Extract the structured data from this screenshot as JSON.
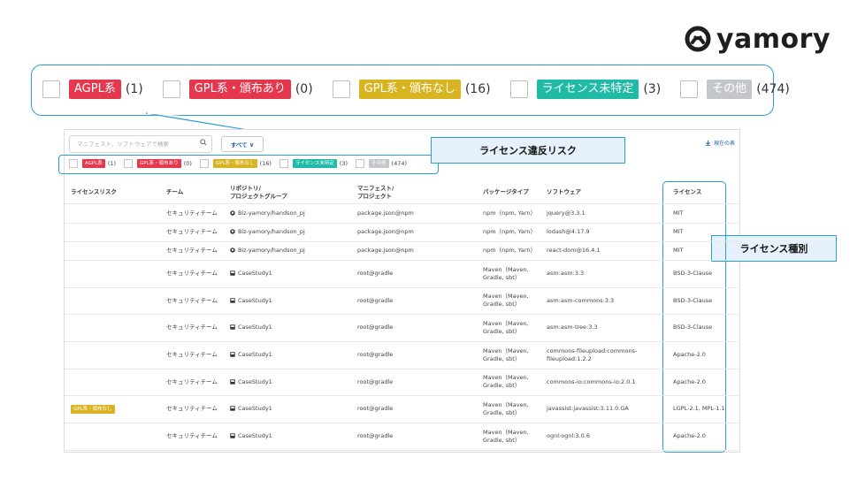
{
  "brand": {
    "name": "yamory",
    "color": "#1e1e1e"
  },
  "colors": {
    "agpl": "#e5384f",
    "gpl_dist": "#e5384f",
    "gpl_nodist": "#d9b421",
    "unknown": "#1fbba6",
    "other": "#c3c7cc",
    "callout": "#2a9fd6"
  },
  "filters": [
    {
      "label": "AGPL系",
      "count": "(1)",
      "color": "#e5384f"
    },
    {
      "label": "GPL系・頒布あり",
      "count": "(0)",
      "color": "#e5384f"
    },
    {
      "label": "GPL系・頒布なし",
      "count": "(16)",
      "color": "#d9b421"
    },
    {
      "label": "ライセンス未特定",
      "count": "(3)",
      "color": "#1fbba6"
    },
    {
      "label": "その他",
      "count": "(474)",
      "color": "#c3c7cc"
    }
  ],
  "toolbar": {
    "search_placeholder": "マニフェスト、ソフトウェアで検索",
    "all_button": "すべて ∨",
    "download": "現在の表"
  },
  "callouts": {
    "risk": "ライセンス違反リスク",
    "type": "ライセンス種別"
  },
  "table": {
    "headers": [
      "ライセンスリスク",
      "チーム",
      "リポジトリ/\nプロジェクトグループ",
      "マニフェスト/\nプロジェクト",
      "パッケージタイプ",
      "ソフトウェア",
      "ライセンス"
    ],
    "rows": [
      {
        "risk": "",
        "team": "セキュリティチーム",
        "repo": "Biz-yamory/handson_pj",
        "repo_icon": "github-icon",
        "manifest": "package.json@npm",
        "pkg": "npm（npm, Yarn）",
        "software": "jquery@3.3.1",
        "license": "MIT"
      },
      {
        "risk": "",
        "team": "セキュリティチーム",
        "repo": "Biz-yamory/handson_pj",
        "repo_icon": "github-icon",
        "manifest": "package.json@npm",
        "pkg": "npm（npm, Yarn）",
        "software": "lodash@4.17.9",
        "license": "MIT"
      },
      {
        "risk": "",
        "team": "セキュリティチーム",
        "repo": "Biz-yamory/handson_pj",
        "repo_icon": "github-icon",
        "manifest": "package.json@npm",
        "pkg": "npm（npm, Yarn）",
        "software": "react-dom@16.4.1",
        "license": "MIT"
      },
      {
        "risk": "",
        "team": "セキュリティチーム",
        "repo": "CaseStudy1",
        "repo_icon": "project-icon",
        "manifest": "root@gradle",
        "pkg": "Maven（Maven,\nGradle, sbt）",
        "software": "asm:asm:3.3",
        "license": "BSD-3-Clause"
      },
      {
        "risk": "",
        "team": "セキュリティチーム",
        "repo": "CaseStudy1",
        "repo_icon": "project-icon",
        "manifest": "root@gradle",
        "pkg": "Maven（Maven,\nGradle, sbt）",
        "software": "asm:asm-commons:3.3",
        "license": "BSD-3-Clause"
      },
      {
        "risk": "",
        "team": "セキュリティチーム",
        "repo": "CaseStudy1",
        "repo_icon": "project-icon",
        "manifest": "root@gradle",
        "pkg": "Maven（Maven,\nGradle, sbt）",
        "software": "asm:asm-tree:3.3",
        "license": "BSD-3-Clause"
      },
      {
        "risk": "",
        "team": "セキュリティチーム",
        "repo": "CaseStudy1",
        "repo_icon": "project-icon",
        "manifest": "root@gradle",
        "pkg": "Maven（Maven,\nGradle, sbt）",
        "software": "commons-fileupload:commons-\nfileupload:1.2.2",
        "license": "Apache-2.0"
      },
      {
        "risk": "",
        "team": "セキュリティチーム",
        "repo": "CaseStudy1",
        "repo_icon": "project-icon",
        "manifest": "root@gradle",
        "pkg": "Maven（Maven,\nGradle, sbt）",
        "software": "commons-io:commons-io:2.0.1",
        "license": "Apache-2.0"
      },
      {
        "risk": "GPL系・頒布なし",
        "team": "セキュリティチーム",
        "repo": "CaseStudy1",
        "repo_icon": "project-icon",
        "manifest": "root@gradle",
        "pkg": "Maven（Maven,\nGradle, sbt）",
        "software": "javassist:javassist:3.11.0.GA",
        "license": "LGPL-2.1, MPL-1.1"
      },
      {
        "risk": "",
        "team": "セキュリティチーム",
        "repo": "CaseStudy1",
        "repo_icon": "project-icon",
        "manifest": "root@gradle",
        "pkg": "Maven（Maven,\nGradle, sbt）",
        "software": "ognl:ognl:3.0.6",
        "license": "Apache-2.0"
      }
    ]
  }
}
